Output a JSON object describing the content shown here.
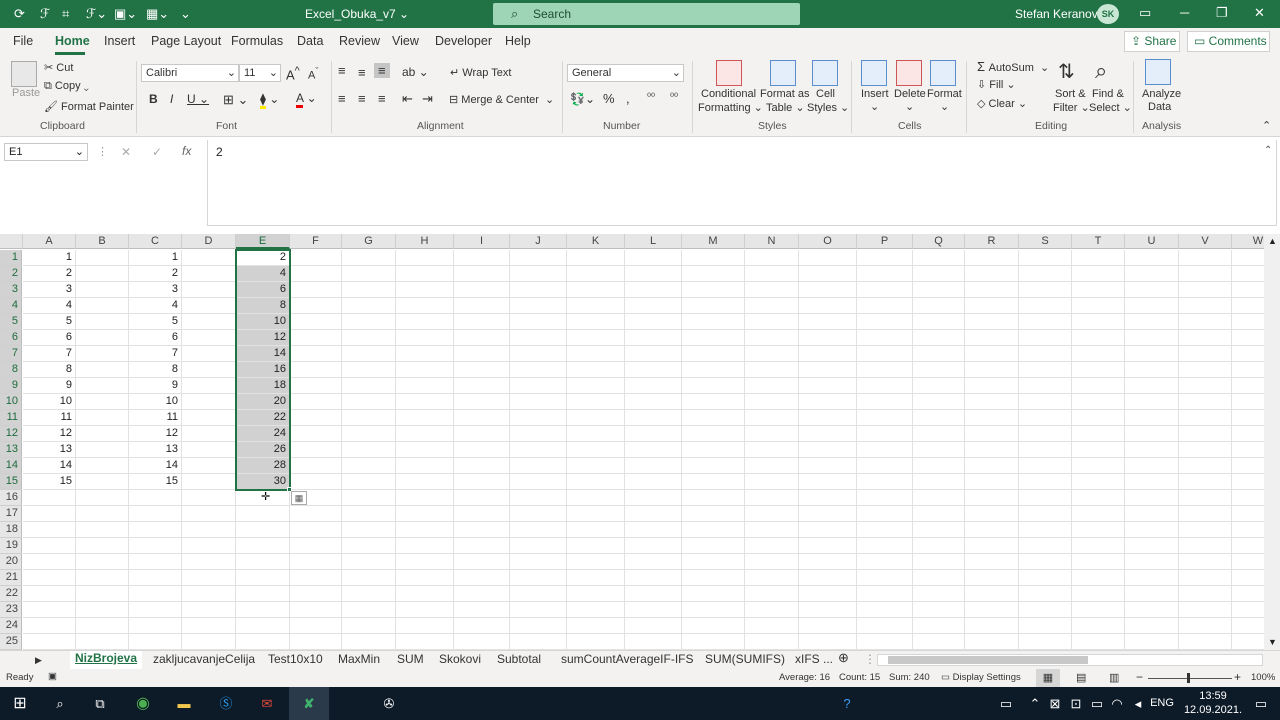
{
  "titlebar": {
    "doc_title": "Excel_Obuka_v7 ⌄",
    "search": "Search",
    "user": "Stefan Keranovic",
    "initials": "SK"
  },
  "tabs": [
    "File",
    "Home",
    "Insert",
    "Page Layout",
    "Formulas",
    "Data",
    "Review",
    "View",
    "Developer",
    "Help"
  ],
  "share": "Share",
  "comments": "Comments",
  "ribbon": {
    "paste": "Paste",
    "cut": "Cut",
    "copy": "Copy",
    "format_painter": "Format Painter",
    "clipboard": "Clipboard",
    "font_name": "Calibri",
    "font_size": "11",
    "font": "Font",
    "wrap_text": "Wrap Text",
    "merge_center": "Merge & Center",
    "alignment": "Alignment",
    "number_format": "General",
    "number": "Number",
    "cond_fmt": [
      "Conditional",
      "Formatting ⌄"
    ],
    "format_table": [
      "Format as",
      "Table ⌄"
    ],
    "cell_styles": [
      "Cell",
      "Styles ⌄"
    ],
    "styles": "Styles",
    "insert": "Insert",
    "delete": "Delete",
    "format": "Format",
    "cells": "Cells",
    "autosum": "AutoSum",
    "fill": "Fill",
    "clear": "Clear",
    "sort_filter": [
      "Sort &",
      "Filter ⌄"
    ],
    "find_select": [
      "Find &",
      "Select ⌄"
    ],
    "editing": "Editing",
    "analyze": [
      "Analyze",
      "Data"
    ],
    "analysis": "Analysis"
  },
  "namebox": "E1",
  "formula": "2",
  "columns": [
    "A",
    "B",
    "C",
    "D",
    "E",
    "F",
    "G",
    "H",
    "I",
    "J",
    "K",
    "L",
    "M",
    "N",
    "O",
    "P",
    "Q",
    "R",
    "S",
    "T",
    "U",
    "V",
    "W"
  ],
  "rows": [
    "1",
    "2",
    "3",
    "4",
    "5",
    "6",
    "7",
    "8",
    "9",
    "10",
    "11",
    "12",
    "13",
    "14",
    "15",
    "16",
    "17",
    "18",
    "19",
    "20",
    "21",
    "22",
    "23",
    "24",
    "25"
  ],
  "colA": [
    "1",
    "2",
    "3",
    "4",
    "5",
    "6",
    "7",
    "8",
    "9",
    "10",
    "11",
    "12",
    "13",
    "14",
    "15"
  ],
  "colC": [
    "1",
    "2",
    "3",
    "4",
    "5",
    "6",
    "7",
    "8",
    "9",
    "10",
    "11",
    "12",
    "13",
    "14",
    "15"
  ],
  "colE": [
    "2",
    "4",
    "6",
    "8",
    "10",
    "12",
    "14",
    "16",
    "18",
    "20",
    "22",
    "24",
    "26",
    "28",
    "30"
  ],
  "sheets": [
    "NizBrojeva",
    "zakljucavanjeCelija",
    "Test10x10",
    "MaxMin",
    "SUM",
    "Skokovi",
    "Subtotal",
    "sumCountAverageIF-IFS",
    "SUM(SUMIFS)",
    "xIFS ..."
  ],
  "status": {
    "ready": "Ready",
    "average": "Average: 16",
    "count": "Count: 15",
    "sum": "Sum: 240",
    "display": "Display Settings",
    "zoom": "100%"
  },
  "taskbar": {
    "lang": "ENG",
    "time": "13:59",
    "date": "12.09.2021."
  }
}
